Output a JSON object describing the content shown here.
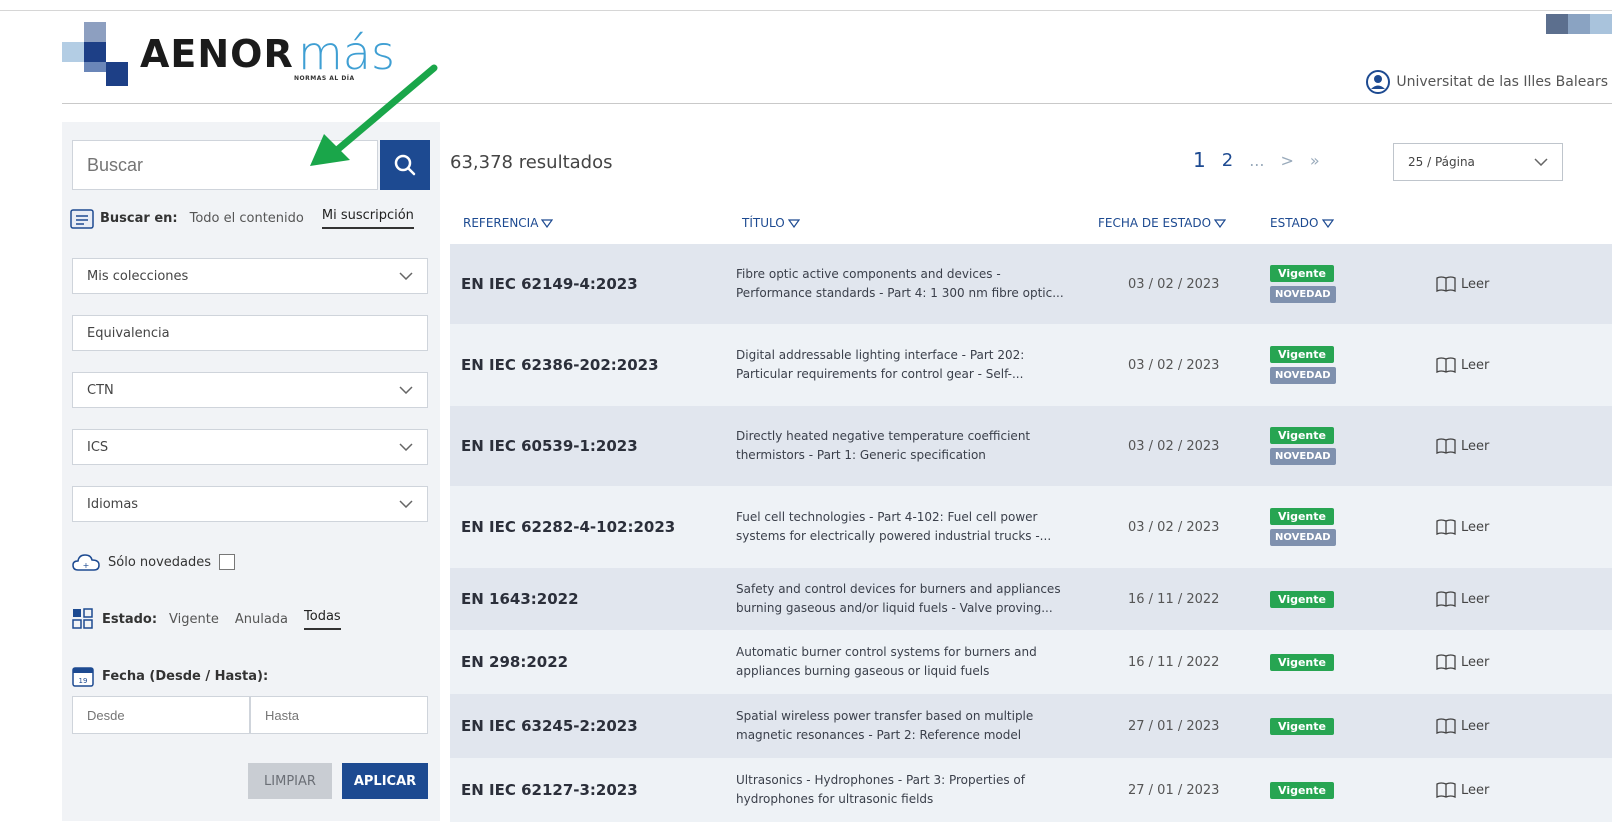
{
  "header": {
    "logo_word": "AENOR",
    "logo_mas": "más",
    "logo_tagline": "NORMAS AL DÍA",
    "user_name": "Universitat de las Illes Balears"
  },
  "colors": {
    "brand_blue": "#1d4a91",
    "accent_light_blue": "#3f9fd3",
    "vigente_green": "#27a552",
    "novedad_gray": "#7f91ae",
    "arrow_green": "#1aa64a"
  },
  "sidebar": {
    "search_placeholder": "Buscar",
    "search_in_label": "Buscar en:",
    "search_in_options": [
      "Todo el contenido",
      "Mi suscripción"
    ],
    "search_in_active": "Mi suscripción",
    "filters": [
      "Mis colecciones",
      "Equivalencia",
      "CTN",
      "ICS",
      "Idiomas"
    ],
    "solo_novedades": "Sólo novedades",
    "estado_label": "Estado:",
    "estado_options": [
      "Vigente",
      "Anulada",
      "Todas"
    ],
    "estado_active": "Todas",
    "fecha_label": "Fecha (Desde / Hasta):",
    "desde_placeholder": "Desde",
    "hasta_placeholder": "Hasta",
    "clear_button": "LIMPIAR",
    "apply_button": "APLICAR"
  },
  "results": {
    "count_text": "63,378 resultados",
    "pages": [
      "1",
      "2",
      "...",
      ">",
      "»"
    ],
    "page_size": "25 / Página",
    "columns": [
      "REFERENCIA",
      "TÍTULO",
      "FECHA DE ESTADO",
      "ESTADO"
    ],
    "read_label": "Leer",
    "rows": [
      {
        "ref": "EN IEC 62149-4:2023",
        "title1": "Fibre optic active components and devices -",
        "title2": "Performance standards - Part 4: 1 300 nm fibre optic...",
        "date": "03 / 02 / 2023",
        "status": "Vigente",
        "novedad": "NOVEDAD"
      },
      {
        "ref": "EN IEC 62386-202:2023",
        "title1": "Digital addressable lighting interface - Part 202:",
        "title2": "Particular requirements for control gear - Self-...",
        "date": "03 / 02 / 2023",
        "status": "Vigente",
        "novedad": "NOVEDAD"
      },
      {
        "ref": "EN IEC 60539-1:2023",
        "title1": "Directly heated negative temperature coefficient",
        "title2": "thermistors - Part 1: Generic specification",
        "date": "03 / 02 / 2023",
        "status": "Vigente",
        "novedad": "NOVEDAD"
      },
      {
        "ref": "EN IEC 62282-4-102:2023",
        "title1": "Fuel cell technologies - Part 4-102: Fuel cell power",
        "title2": "systems for electrically powered industrial trucks -...",
        "date": "03 / 02 / 2023",
        "status": "Vigente",
        "novedad": "NOVEDAD"
      },
      {
        "ref": "EN 1643:2022",
        "title1": "Safety and control devices for burners and appliances",
        "title2": "burning gaseous and/or liquid fuels - Valve proving...",
        "date": "16 / 11 / 2022",
        "status": "Vigente",
        "novedad": ""
      },
      {
        "ref": "EN 298:2022",
        "title1": "Automatic burner control systems for burners and",
        "title2": "appliances burning gaseous or liquid fuels",
        "date": "16 / 11 / 2022",
        "status": "Vigente",
        "novedad": ""
      },
      {
        "ref": "EN IEC 63245-2:2023",
        "title1": "Spatial wireless power transfer based on multiple",
        "title2": "magnetic resonances - Part 2: Reference model",
        "date": "27 / 01 / 2023",
        "status": "Vigente",
        "novedad": ""
      },
      {
        "ref": "EN IEC 62127-3:2023",
        "title1": "Ultrasonics - Hydrophones - Part 3: Properties of",
        "title2": "hydrophones for ultrasonic fields",
        "date": "27 / 01 / 2023",
        "status": "Vigente",
        "novedad": ""
      }
    ]
  }
}
